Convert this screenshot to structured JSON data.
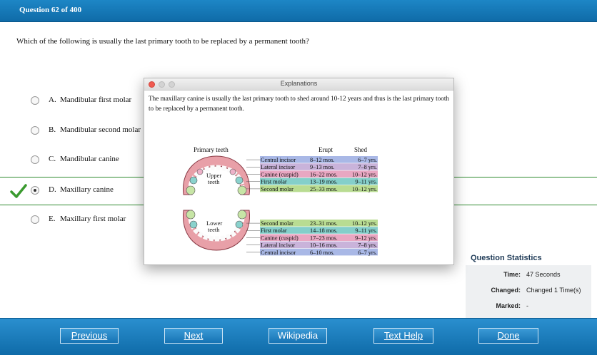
{
  "header": {
    "question_number": "Question 62 of 400"
  },
  "question": {
    "text": "Which of the following is usually the last primary tooth to be replaced by a permanent tooth?"
  },
  "choices": [
    {
      "letter": "A.",
      "text": "Mandibular first molar",
      "selected": false,
      "correct": false
    },
    {
      "letter": "B.",
      "text": "Mandibular second molar",
      "selected": false,
      "correct": false
    },
    {
      "letter": "C.",
      "text": "Mandibular canine",
      "selected": false,
      "correct": false
    },
    {
      "letter": "D.",
      "text": "Maxillary canine",
      "selected": true,
      "correct": true
    },
    {
      "letter": "E.",
      "text": "Maxillary first molar",
      "selected": false,
      "correct": false
    }
  ],
  "dialog": {
    "title": "Explanations",
    "explanation": "The maxillary canine is usually the last primary tooth to shed around 10-12 years and thus is the last primary tooth to be replaced by a permanent tooth.",
    "figure": {
      "heading": "Primary teeth",
      "col_erupt": "Erupt",
      "col_shed": "Shed",
      "upper_label_1": "Upper",
      "upper_label_2": "teeth",
      "lower_label_1": "Lower",
      "lower_label_2": "teeth",
      "upper_rows": [
        {
          "name": "Central incisor",
          "erupt": "8–12 mos.",
          "shed": "6–7 yrs.",
          "color": "#a9b8e6"
        },
        {
          "name": "Lateral incisor",
          "erupt": "9–13 mos.",
          "shed": "7–8 yrs.",
          "color": "#c9b3da"
        },
        {
          "name": "Canine (cuspid)",
          "erupt": "16–22 mos.",
          "shed": "10–12 yrs.",
          "color": "#e9a7c2"
        },
        {
          "name": "First molar",
          "erupt": "13–19 mos.",
          "shed": "9–11 yrs.",
          "color": "#84cfca"
        },
        {
          "name": "Second molar",
          "erupt": "25–33 mos.",
          "shed": "10–12 yrs.",
          "color": "#b9dc92"
        }
      ],
      "lower_rows": [
        {
          "name": "Second molar",
          "erupt": "23–31 mos.",
          "shed": "10–12 yrs.",
          "color": "#b9dc92"
        },
        {
          "name": "First molar",
          "erupt": "14–18 mos.",
          "shed": "9–11 yrs.",
          "color": "#84cfca"
        },
        {
          "name": "Canine (cuspid)",
          "erupt": "17–23 mos.",
          "shed": "9–12 yrs.",
          "color": "#e9a7c2"
        },
        {
          "name": "Lateral incisor",
          "erupt": "10–16 mos.",
          "shed": "7–8 yrs.",
          "color": "#c9b3da"
        },
        {
          "name": "Central incisor",
          "erupt": "6–10 mos.",
          "shed": "6–7 yrs.",
          "color": "#a9b8e6"
        }
      ]
    }
  },
  "stats": {
    "title": "Question Statistics",
    "time_label": "Time:",
    "time_value": "47 Seconds",
    "changed_label": "Changed:",
    "changed_value": "Changed 1 Time(s)",
    "marked_label": "Marked:",
    "marked_value": "-"
  },
  "nav": {
    "previous": "Previous",
    "next": "Next",
    "wikipedia": "Wikipedia",
    "text_help": "Text Help",
    "done": "Done"
  },
  "colors": {
    "header_blue": "#1677b8",
    "correct_green": "#3a9a2f"
  }
}
